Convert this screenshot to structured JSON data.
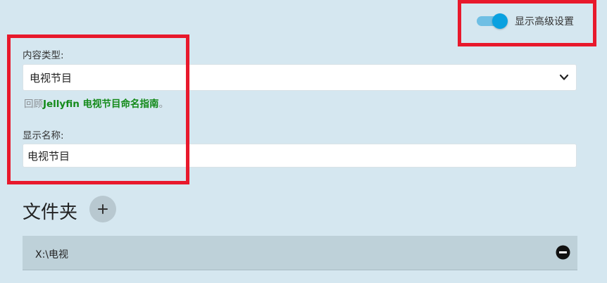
{
  "advanced_settings": {
    "label": "显示高级设置",
    "enabled": true
  },
  "content_type": {
    "label": "内容类型:",
    "value": "电视节目"
  },
  "hint": {
    "prefix": "回顾",
    "link_text": "Jellyfin 电视节目命名指南",
    "suffix": "。"
  },
  "display_name": {
    "label": "显示名称:",
    "value": "电视节目"
  },
  "folders": {
    "title": "文件夹",
    "items": [
      {
        "path": "X:\\电视"
      }
    ]
  },
  "colors": {
    "background": "#d5e7f0",
    "accent": "#0aa1e0",
    "link": "#138a19",
    "highlight": "#e8192c"
  },
  "icons": {
    "add": "plus-icon",
    "remove": "minus-circle-icon",
    "select": "chevron-down-icon"
  }
}
